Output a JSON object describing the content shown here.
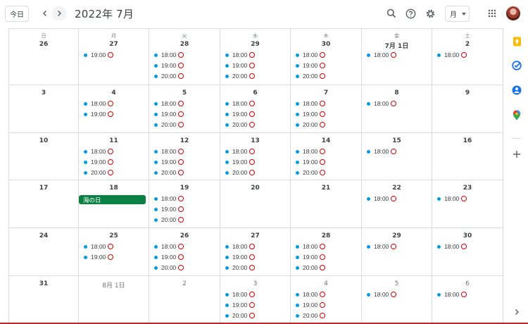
{
  "header": {
    "today_label": "今日",
    "title": "2022年 7月",
    "view_label": "月",
    "icons": [
      "chevron-left-icon",
      "chevron-right-icon",
      "search-icon",
      "help-icon",
      "gear-icon",
      "apps-grid-icon",
      "avatar"
    ]
  },
  "weekdays": [
    "日",
    "月",
    "火",
    "水",
    "木",
    "金",
    "土"
  ],
  "colors": {
    "event_dot": "#039be5",
    "ring": "#d50000",
    "holiday": "#0b8043",
    "grid": "#dadce0"
  },
  "ring_symbol": "◯",
  "weeks": [
    [
      {
        "label": "26",
        "dim": false,
        "events": []
      },
      {
        "label": "27",
        "dim": false,
        "events": [
          "19:00"
        ]
      },
      {
        "label": "28",
        "dim": false,
        "events": [
          "18:00",
          "19:00",
          "20:00"
        ]
      },
      {
        "label": "29",
        "dim": false,
        "events": [
          "18:00",
          "19:00",
          "20:00"
        ]
      },
      {
        "label": "30",
        "dim": false,
        "events": [
          "18:00",
          "19:00",
          "20:00"
        ]
      },
      {
        "label": "7月 1日",
        "dim": false,
        "events": [
          "18:00"
        ]
      },
      {
        "label": "2",
        "dim": false,
        "events": [
          "18:00"
        ]
      }
    ],
    [
      {
        "label": "3",
        "dim": false,
        "events": []
      },
      {
        "label": "4",
        "dim": false,
        "events": [
          "18:00",
          "19:00"
        ]
      },
      {
        "label": "5",
        "dim": false,
        "events": [
          "18:00",
          "19:00",
          "20:00"
        ]
      },
      {
        "label": "6",
        "dim": false,
        "events": [
          "18:00",
          "19:00",
          "20:00"
        ]
      },
      {
        "label": "7",
        "dim": false,
        "events": [
          "18:00",
          "19:00",
          "20:00"
        ]
      },
      {
        "label": "8",
        "dim": false,
        "events": [
          "18:00"
        ]
      },
      {
        "label": "9",
        "dim": false,
        "events": []
      }
    ],
    [
      {
        "label": "10",
        "dim": false,
        "events": []
      },
      {
        "label": "11",
        "dim": false,
        "events": [
          "18:00",
          "19:00",
          "20:00"
        ]
      },
      {
        "label": "12",
        "dim": false,
        "events": [
          "18:00",
          "19:00",
          "20:00"
        ]
      },
      {
        "label": "13",
        "dim": false,
        "events": [
          "18:00",
          "19:00",
          "20:00"
        ]
      },
      {
        "label": "14",
        "dim": false,
        "events": [
          "18:00",
          "19:00",
          "20:00"
        ]
      },
      {
        "label": "15",
        "dim": false,
        "events": [
          "18:00"
        ]
      },
      {
        "label": "16",
        "dim": false,
        "events": []
      }
    ],
    [
      {
        "label": "17",
        "dim": false,
        "events": []
      },
      {
        "label": "18",
        "dim": false,
        "holiday": "海の日",
        "events": []
      },
      {
        "label": "19",
        "dim": false,
        "events": [
          "18:00",
          "19:00",
          "20:00"
        ]
      },
      {
        "label": "20",
        "dim": false,
        "events": []
      },
      {
        "label": "21",
        "dim": false,
        "events": []
      },
      {
        "label": "22",
        "dim": false,
        "events": [
          "18:00"
        ]
      },
      {
        "label": "23",
        "dim": false,
        "events": [
          "18:00"
        ]
      }
    ],
    [
      {
        "label": "24",
        "dim": false,
        "events": []
      },
      {
        "label": "25",
        "dim": false,
        "events": [
          "18:00",
          "19:00"
        ]
      },
      {
        "label": "26",
        "dim": false,
        "events": [
          "18:00",
          "19:00",
          "20:00"
        ]
      },
      {
        "label": "27",
        "dim": false,
        "events": [
          "18:00",
          "19:00",
          "20:00"
        ]
      },
      {
        "label": "28",
        "dim": false,
        "events": [
          "18:00",
          "19:00",
          "20:00"
        ]
      },
      {
        "label": "29",
        "dim": false,
        "events": [
          "18:00"
        ]
      },
      {
        "label": "30",
        "dim": false,
        "events": [
          "18:00"
        ]
      }
    ],
    [
      {
        "label": "31",
        "dim": false,
        "events": []
      },
      {
        "label": "8月 1日",
        "dim": true,
        "events": []
      },
      {
        "label": "2",
        "dim": true,
        "events": []
      },
      {
        "label": "3",
        "dim": true,
        "events": [
          "18:00",
          "19:00",
          "20:00"
        ]
      },
      {
        "label": "4",
        "dim": true,
        "events": [
          "18:00",
          "19:00",
          "20:00"
        ]
      },
      {
        "label": "5",
        "dim": true,
        "events": [
          "18:00"
        ]
      },
      {
        "label": "6",
        "dim": true,
        "events": [
          "18:00"
        ]
      }
    ]
  ],
  "side_panel": [
    "keep-icon",
    "tasks-icon",
    "contacts-icon",
    "maps-icon",
    "add-icon",
    "chevron-right-icon"
  ]
}
